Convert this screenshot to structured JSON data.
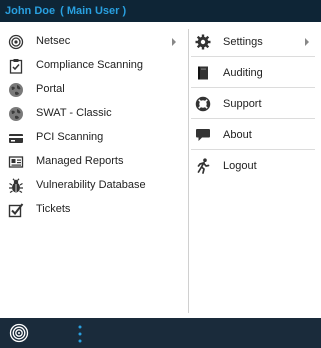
{
  "header": {
    "user_name": "John Doe",
    "role": "( Main User )"
  },
  "left_menu": [
    {
      "label": "Netsec",
      "icon": "target-icon",
      "has_submenu": true
    },
    {
      "label": "Compliance Scanning",
      "icon": "clipboard-check-icon",
      "has_submenu": false
    },
    {
      "label": "Portal",
      "icon": "globe-icon",
      "has_submenu": false
    },
    {
      "label": "SWAT - Classic",
      "icon": "globe-icon",
      "has_submenu": false
    },
    {
      "label": "PCI Scanning",
      "icon": "credit-card-icon",
      "has_submenu": false
    },
    {
      "label": "Managed Reports",
      "icon": "report-card-icon",
      "has_submenu": false
    },
    {
      "label": "Vulnerability Database",
      "icon": "bug-icon",
      "has_submenu": false
    },
    {
      "label": "Tickets",
      "icon": "checkbox-icon",
      "has_submenu": false
    }
  ],
  "right_menu": [
    {
      "label": "Settings",
      "icon": "gear-icon",
      "has_submenu": true
    },
    {
      "label": "Auditing",
      "icon": "book-icon",
      "has_submenu": false
    },
    {
      "label": "Support",
      "icon": "lifebuoy-icon",
      "has_submenu": false
    },
    {
      "label": "About",
      "icon": "speech-bubble-icon",
      "has_submenu": false
    },
    {
      "label": "Logout",
      "icon": "running-man-icon",
      "has_submenu": false
    }
  ],
  "footer": {
    "logo_icon": "target-logo-icon",
    "menu_icon": "vertical-dots-icon"
  },
  "colors": {
    "header_bg": "#0e2536",
    "header_text": "#29a0e0",
    "footer_bg": "#1a2b3b",
    "accent": "#29a0e0"
  }
}
